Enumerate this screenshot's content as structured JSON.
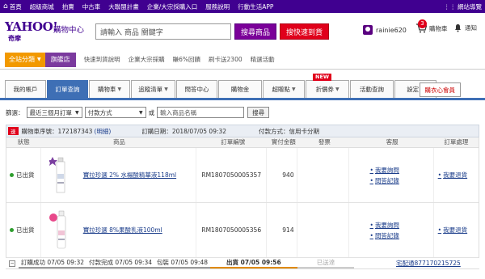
{
  "topnav": {
    "items": [
      "首頁",
      "超級商城",
      "拍賣",
      "中古車",
      "大聯盟計畫",
      "企業/大宗採購入口",
      "服務說明",
      "行動生活APP"
    ],
    "site_nav": "網站導覽"
  },
  "header": {
    "logo_text": "YAHOO!",
    "logo_sub": "奇摩",
    "site_name": "購物中心",
    "search_placeholder": "請輸入 商品 關鍵字",
    "search_btn": "搜尋商品",
    "fast_btn": "搜快速到貨",
    "username": "rainie620",
    "cart_label": "購物車",
    "cart_count": "3",
    "notify_label": "通知"
  },
  "categories": {
    "all": "全站分類",
    "store": "旗艦店",
    "links": [
      "快速到貨說明",
      "企業大宗採購",
      "賺6%回饋",
      "刷卡送2300",
      "精選活動"
    ]
  },
  "tabs": [
    {
      "label": "我的帳戶",
      "dd": false
    },
    {
      "label": "訂單查詢",
      "dd": false
    },
    {
      "label": "購物車",
      "dd": true
    },
    {
      "label": "追蹤清單",
      "dd": true
    },
    {
      "label": "問答中心",
      "dd": false
    },
    {
      "label": "購物金",
      "dd": false
    },
    {
      "label": "超贈點",
      "dd": true
    },
    {
      "label": "折價券",
      "dd": true,
      "new": "NEW"
    },
    {
      "label": "活動查詢",
      "dd": false
    },
    {
      "label": "設定",
      "dd": true
    }
  ],
  "vip_tab": "購衣心會員",
  "filter": {
    "label": "篩選：",
    "period": "最近三個月訂單",
    "payment": "付款方式",
    "or": "或",
    "placeholder": "輸入商品名稱",
    "go": "搜尋"
  },
  "order": {
    "tag": "速",
    "number_label": "購物車序號：",
    "number": "172187343",
    "detail": "(明細)",
    "date_label": "訂購日期：",
    "date": "2018/07/05 09:32",
    "payment_label": "付款方式：",
    "payment": "信用卡分期"
  },
  "columns": [
    "狀態",
    "商品",
    "訂單編號",
    "實付金額",
    "發票",
    "客服",
    "訂單處理"
  ],
  "rows": [
    {
      "status": "已出貨",
      "product": "寶拉珍選 2% 水楊酸精華液118ml",
      "order_no": "RM1807050005357",
      "amount": "940",
      "invoice": "",
      "service": [
        "我要詢問",
        "問答記錄"
      ],
      "process": [
        "我要退貨"
      ]
    },
    {
      "status": "已出貨",
      "product": "寶拉珍選 8%果酸乳液100ml",
      "order_no": "RM1807050005356",
      "amount": "914",
      "invoice": "",
      "service": [
        "我要詢問",
        "問答記錄"
      ],
      "process": [
        "我要退貨"
      ]
    }
  ],
  "progress": {
    "steps": [
      "訂購成功 07/05 09:32",
      "付款完成 07/05 09:34",
      "包裝 07/05 09:48",
      "出貨 07/05 09:56",
      "已送達"
    ],
    "tracking": "宅配通877170215725"
  }
}
